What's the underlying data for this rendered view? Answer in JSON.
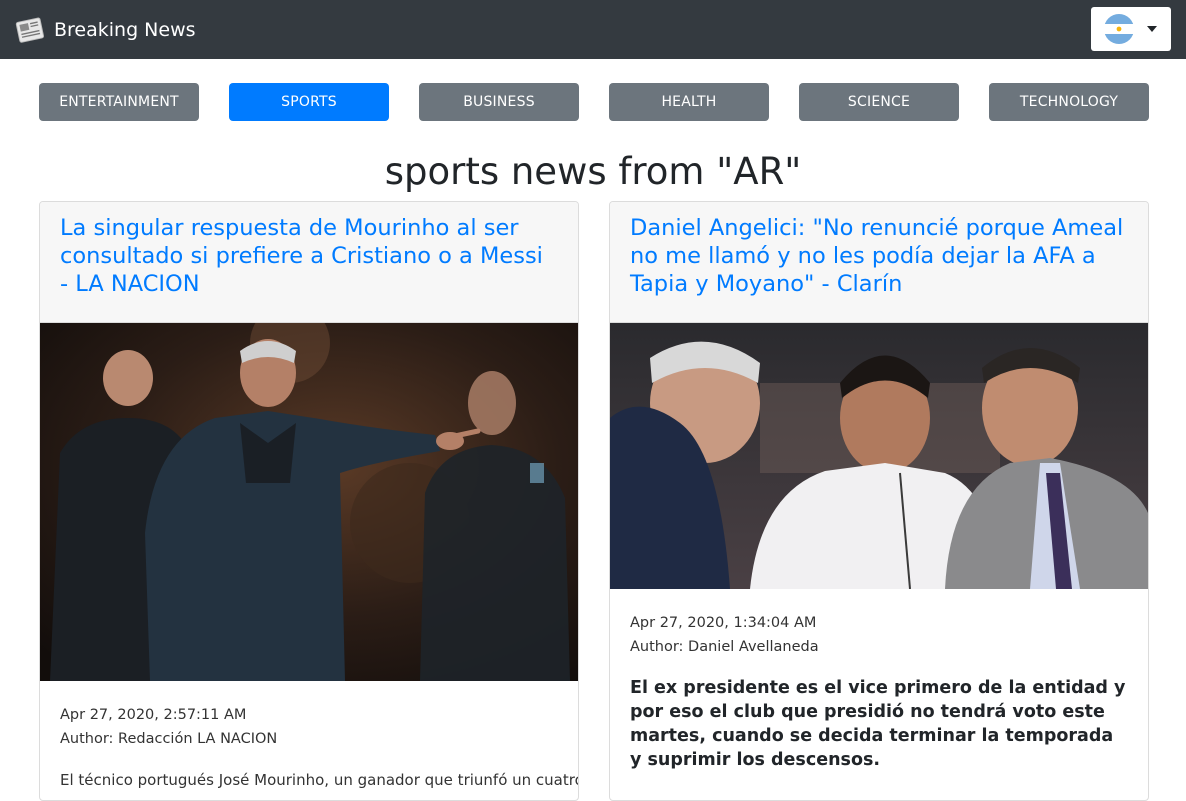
{
  "app": {
    "title": "Breaking News",
    "country_code": "AR"
  },
  "categories": [
    {
      "label": "ENTERTAINMENT",
      "active": false
    },
    {
      "label": "SPORTS",
      "active": true
    },
    {
      "label": "BUSINESS",
      "active": false
    },
    {
      "label": "HEALTH",
      "active": false
    },
    {
      "label": "SCIENCE",
      "active": false
    },
    {
      "label": "TECHNOLOGY",
      "active": false
    }
  ],
  "page_title": "sports news from \"AR\"",
  "articles": [
    {
      "title": "La singular respuesta de Mourinho al ser consultado si prefiere a Cristiano o a Messi - LA NACION",
      "date": "Apr 27, 2020, 2:57:11 AM",
      "author": "Author: Redacción LA NACION",
      "body": "El técnico portugués José Mourinho, un ganador que triunfó un cuatro"
    },
    {
      "title": "Daniel Angelici: \"No renuncié porque Ameal no me llamó y no les podía dejar la AFA a Tapia y Moyano\" - Clarín",
      "date": "Apr 27, 2020, 1:34:04 AM",
      "author": "Author: Daniel Avellaneda",
      "description": "El ex presidente es el vice primero de la entidad y por eso el club que presidió no tendrá voto este martes, cuando se decida terminar la temporada y suprimir los descensos."
    }
  ],
  "colors": {
    "navbar": "#343a40",
    "active_button": "#007bff",
    "inactive_button": "#6c757d",
    "link": "#007bff"
  }
}
